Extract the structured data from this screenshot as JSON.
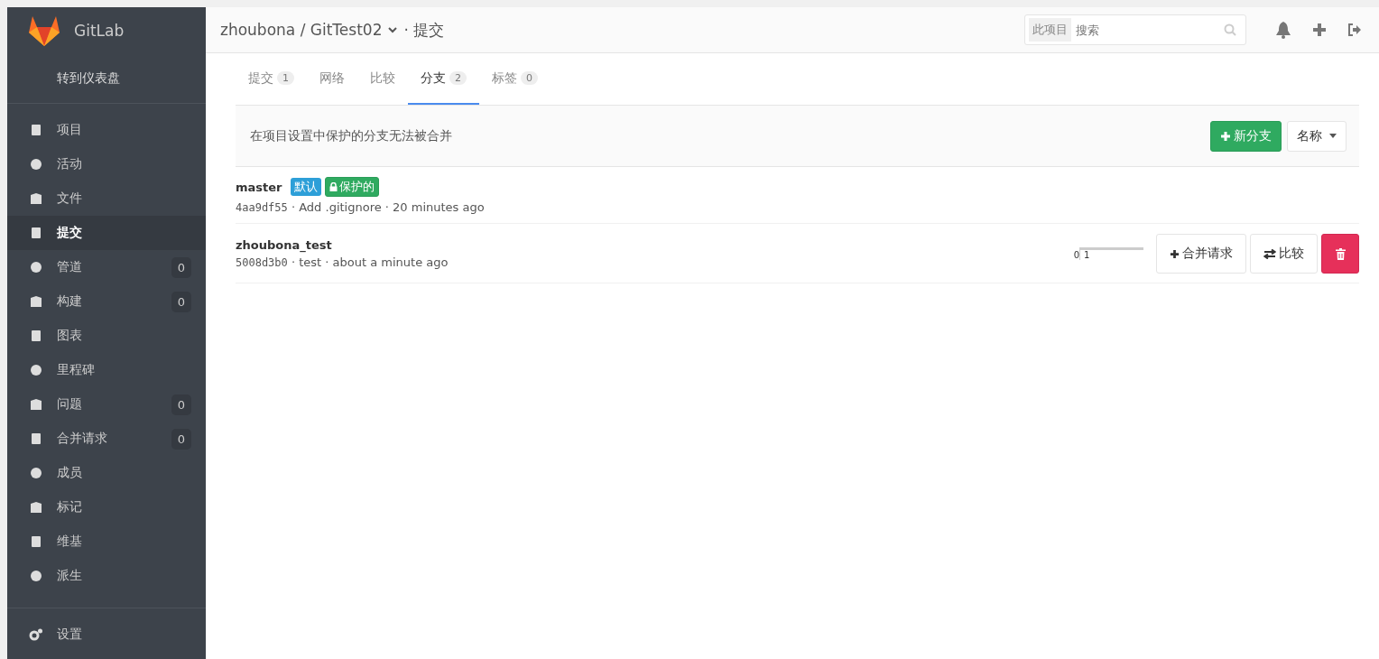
{
  "brand": "GitLab",
  "dashboard_link": "转到仪表盘",
  "sidebar": {
    "items": [
      {
        "label": "项目",
        "selected": false
      },
      {
        "label": "活动",
        "selected": false
      },
      {
        "label": "文件",
        "selected": false
      },
      {
        "label": "提交",
        "selected": true
      },
      {
        "label": "管道",
        "selected": false,
        "count": "0"
      },
      {
        "label": "构建",
        "selected": false,
        "count": "0"
      },
      {
        "label": "图表",
        "selected": false
      },
      {
        "label": "里程碑",
        "selected": false
      },
      {
        "label": "问题",
        "selected": false,
        "count": "0"
      },
      {
        "label": "合并请求",
        "selected": false,
        "count": "0"
      },
      {
        "label": "成员",
        "selected": false
      },
      {
        "label": "标记",
        "selected": false
      },
      {
        "label": "维基",
        "selected": false
      },
      {
        "label": "派生",
        "selected": false
      }
    ],
    "settings": "设置"
  },
  "header": {
    "breadcrumb": "zhoubona / GitTest02",
    "page": "· 提交",
    "search_scope": "此项目",
    "search_placeholder": "搜索"
  },
  "tabs": [
    {
      "label": "提交",
      "count": "1",
      "selected": false
    },
    {
      "label": "网络",
      "selected": false
    },
    {
      "label": "比较",
      "selected": false
    },
    {
      "label": "分支",
      "count": "2",
      "selected": true
    },
    {
      "label": "标签",
      "count": "0",
      "selected": false
    }
  ],
  "notice": "在项目设置中保护的分支无法被合并",
  "new_branch_button": "新分支",
  "sort_button": "名称",
  "branches": [
    {
      "name": "master",
      "badges": [
        {
          "kind": "default",
          "label": "默认"
        },
        {
          "kind": "protected",
          "label": "保护的"
        }
      ],
      "sha": "4aa9df55",
      "message": " · Add .gitignore · 20 minutes ago"
    },
    {
      "name": "zhoubona_test",
      "sha": "5008d3b0",
      "message": " · test · about a minute ago",
      "behind": "0",
      "ahead": "1",
      "merge_button": "合并请求",
      "compare_button": "比较"
    }
  ]
}
